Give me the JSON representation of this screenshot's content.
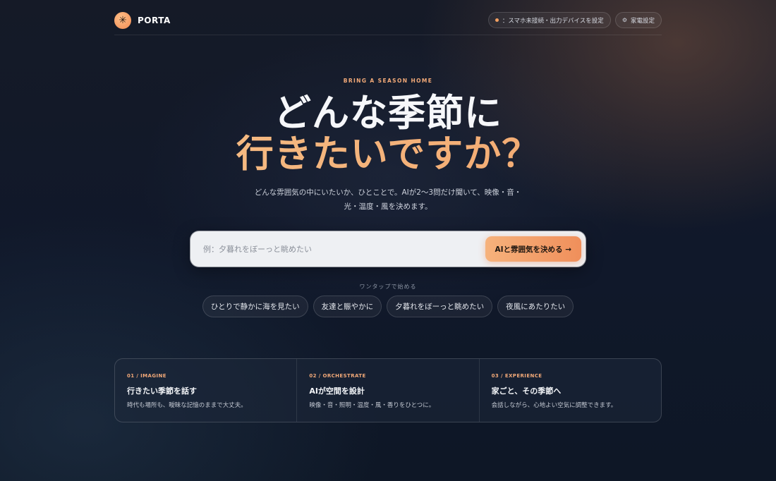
{
  "header": {
    "logo_glyph": "✳",
    "brand": "PORTA",
    "status_text": "：スマホ未接続・出力デバイスを設定",
    "status_dot_color": "#f3a062",
    "settings_icon": "gear-icon",
    "settings_glyph": "⚙",
    "settings_label": "家電設定"
  },
  "hero": {
    "eyebrow": "BRING A SEASON HOME",
    "title_line1": "どんな季節に",
    "title_line2": "行きたいですか？",
    "subtitle_line1": "どんな雰囲気の中にいたいか、ひとことで。AIが2〜3問だけ聞いて、映像・音・",
    "subtitle_line2": "光・温度・風を決めます。"
  },
  "search": {
    "placeholder": "例：夕暮れをぼーっと眺めたい",
    "value": "",
    "button_label": "AIと雰囲気を決める →"
  },
  "quick_start": {
    "label": "ワンタップで始める",
    "chips": [
      "ひとりで静かに海を見たい",
      "友達と賑やかに",
      "夕暮れをぼーっと眺めたい",
      "夜風にあたりたい"
    ]
  },
  "steps": [
    {
      "tag": "01 / IMAGINE",
      "title": "行きたい季節を話す",
      "desc": "時代も場所も、曖昧な記憶のままで大丈夫。"
    },
    {
      "tag": "02 / ORCHESTRATE",
      "title": "AIが空間を設計",
      "desc": "映像・音・照明・温度・風・香りをひとつに。"
    },
    {
      "tag": "03 / EXPERIENCE",
      "title": "家ごと、その季節へ",
      "desc": "会話しながら、心地よい空気に調整できます。"
    }
  ],
  "colors": {
    "accent": "#f2a978",
    "cta_start": "#f6b27c",
    "cta_end": "#f08f5b",
    "background": "#10182a"
  }
}
